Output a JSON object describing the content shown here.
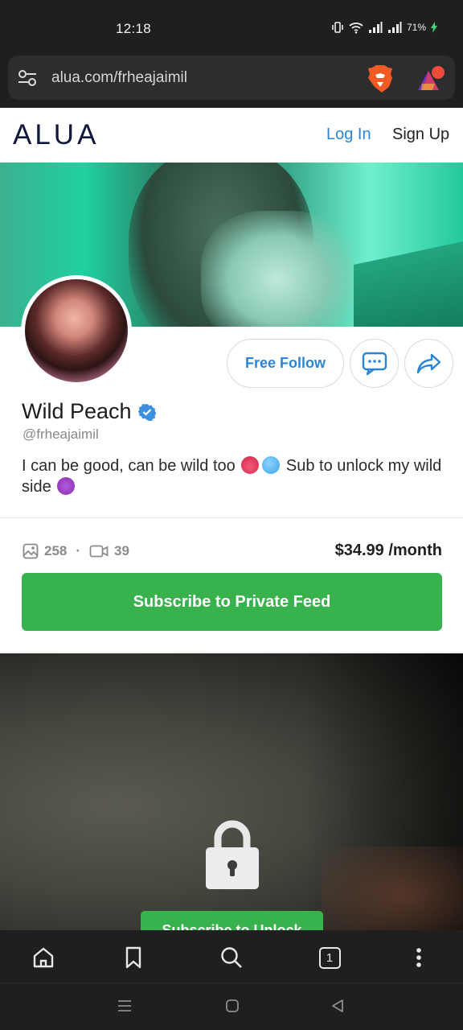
{
  "status_bar": {
    "time": "12:18",
    "battery": "71%"
  },
  "browser": {
    "url": "alua.com/frheajaimil",
    "tab_count": "1"
  },
  "header": {
    "logo": "ALUA",
    "login_label": "Log In",
    "signup_label": "Sign Up"
  },
  "profile": {
    "display_name": "Wild Peach",
    "username": "@frheajaimil",
    "bio_part1": "I can be good, can be wild too",
    "bio_part2": "Sub to unlock my wild side",
    "follow_label": "Free Follow",
    "photo_count": "258",
    "separator": "·",
    "video_count": "39",
    "price": "$34.99 /month",
    "subscribe_label": "Subscribe to Private Feed"
  },
  "locked_post": {
    "unlock_label": "Subscribe to Unlock"
  },
  "icons": {
    "verified": "verified-badge-icon",
    "message": "chat-bubble-icon",
    "share": "share-arrow-icon",
    "lock": "lock-icon"
  },
  "colors": {
    "accent_blue": "#2a86d4",
    "subscribe_green": "#37b24d",
    "logo_navy": "#12183a"
  }
}
